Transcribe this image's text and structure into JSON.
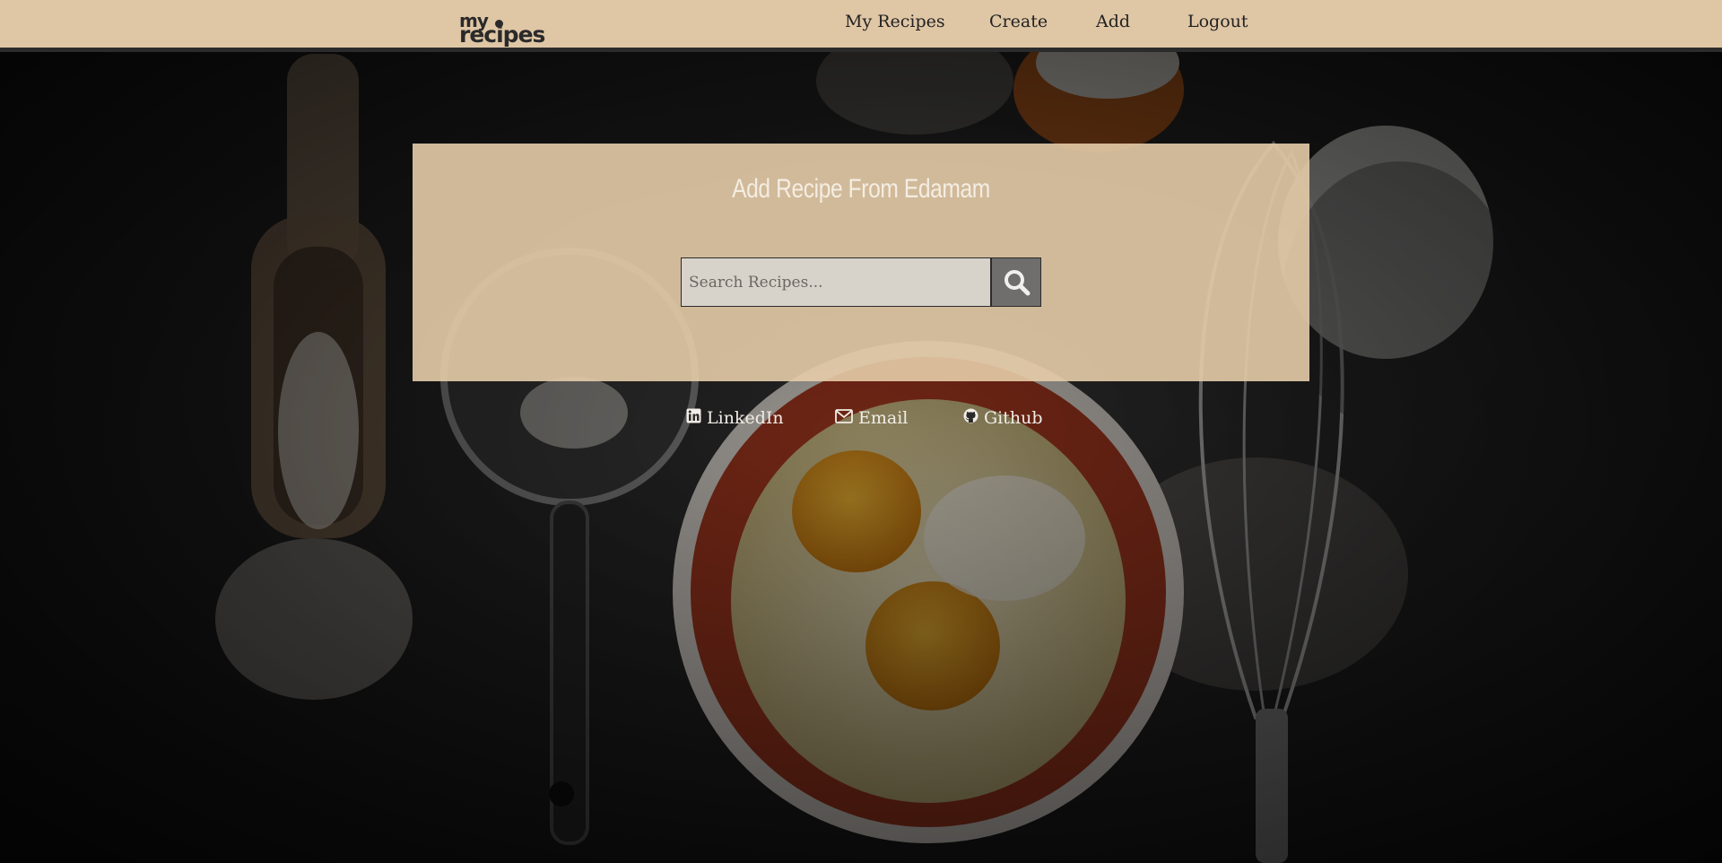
{
  "app": {
    "logo": {
      "line1": "my",
      "line2": "recipes"
    }
  },
  "nav": {
    "items": [
      {
        "label": "My Recipes"
      },
      {
        "label": "Create"
      },
      {
        "label": "Add"
      },
      {
        "label": "Logout"
      }
    ]
  },
  "card": {
    "title": "Add Recipe From Edamam",
    "search": {
      "placeholder": "Search Recipes...",
      "value": "",
      "button_icon": "search-icon"
    }
  },
  "footer": {
    "links": [
      {
        "label": "LinkedIn",
        "icon": "linkedin-icon"
      },
      {
        "label": "Email",
        "icon": "envelope-icon"
      },
      {
        "label": "Github",
        "icon": "github-icon"
      }
    ]
  },
  "colors": {
    "navbar_bg": "#dfc6a5",
    "card_bg": "#e6cca8",
    "search_button_bg": "#6f6e6c",
    "nav_text": "#222222",
    "footer_text": "#f1ede6"
  }
}
